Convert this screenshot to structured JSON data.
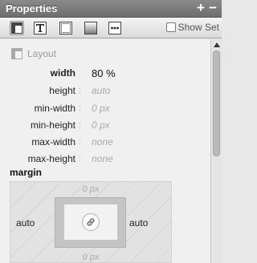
{
  "panel": {
    "title": "Properties",
    "add_icon": "+",
    "remove_icon": "−"
  },
  "toolbar": {
    "tabs": [
      {
        "icon": "layout-icon",
        "active": true
      },
      {
        "icon": "text-icon",
        "active": false
      },
      {
        "icon": "border-icon",
        "active": false
      },
      {
        "icon": "background-icon",
        "active": false
      },
      {
        "icon": "more-icon",
        "active": false
      }
    ],
    "show_set_label": "Show Set"
  },
  "section": {
    "title": "Layout"
  },
  "properties": [
    {
      "label": "width",
      "value": "80 %",
      "is_set": true
    },
    {
      "label": "height",
      "value": "auto",
      "is_set": false
    },
    {
      "label": "min-width",
      "value": "0 px",
      "is_set": false
    },
    {
      "label": "min-height",
      "value": "0 px",
      "is_set": false
    },
    {
      "label": "max-width",
      "value": "none",
      "is_set": false
    },
    {
      "label": "max-height",
      "value": "none",
      "is_set": false
    }
  ],
  "margin": {
    "title": "margin",
    "top": "0 px",
    "bottom": "0 px",
    "left": "auto",
    "right": "auto"
  }
}
